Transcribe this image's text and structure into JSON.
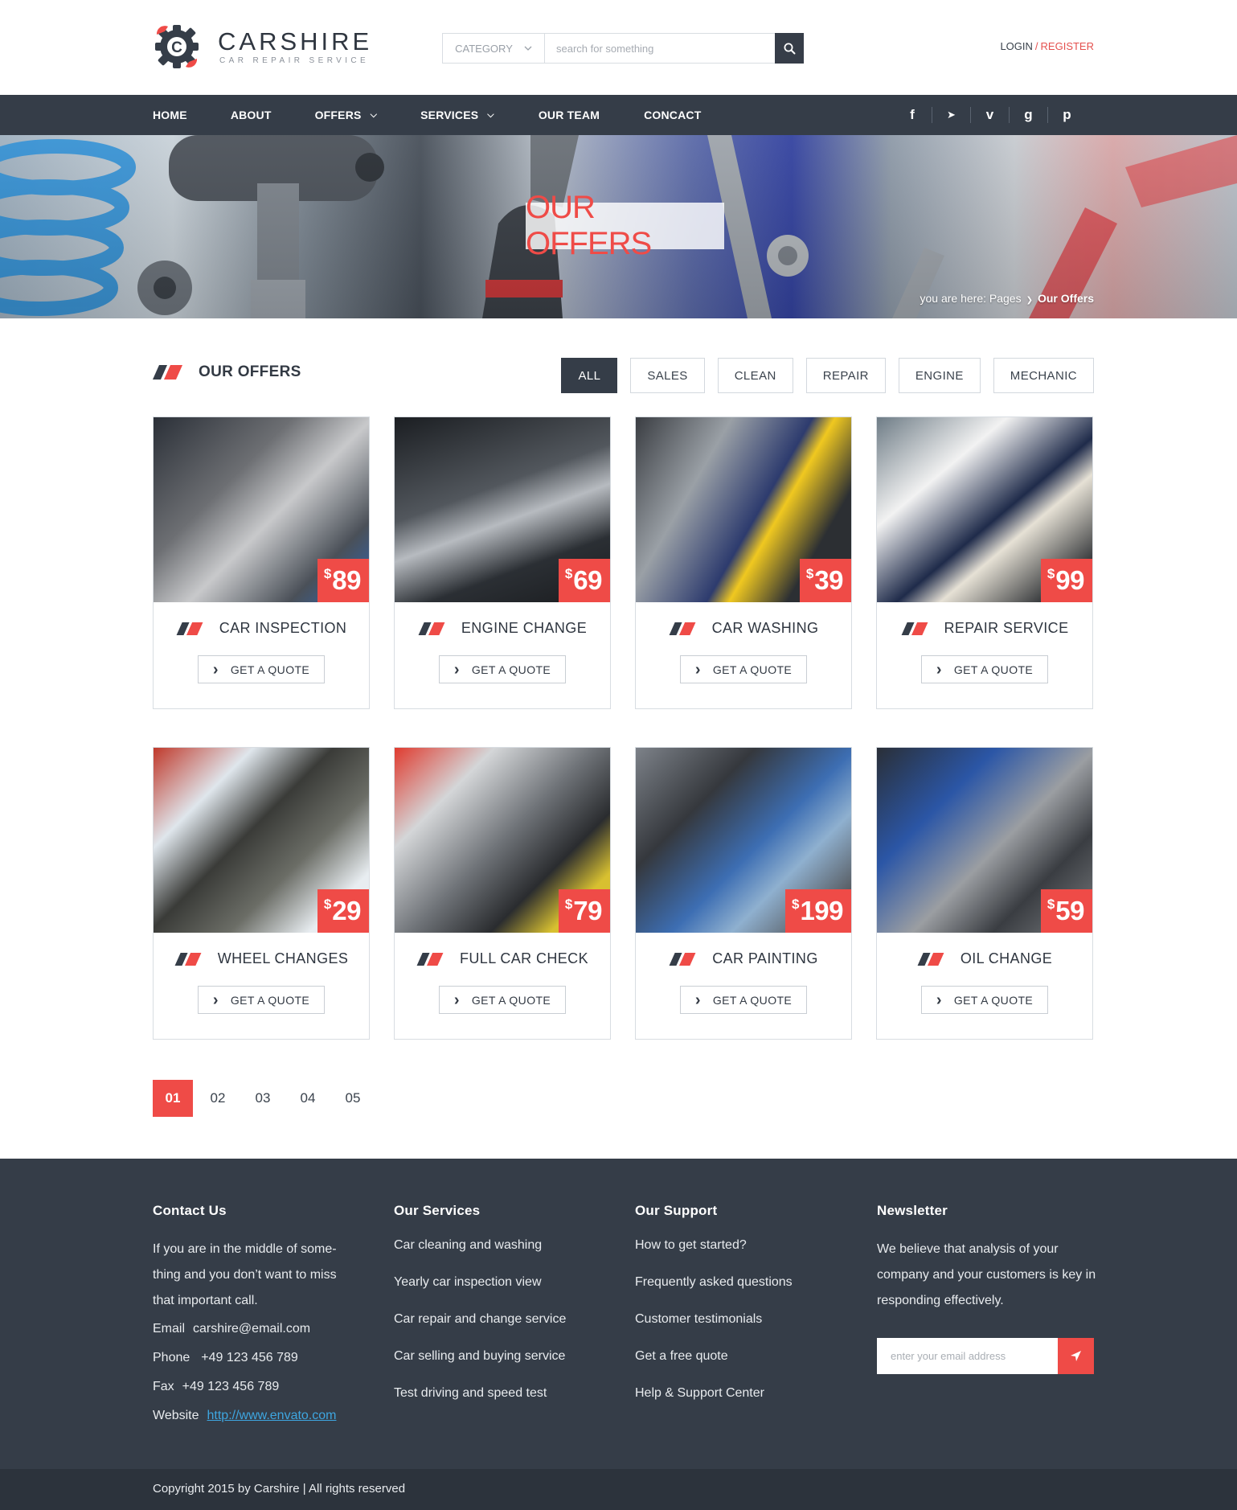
{
  "brand": {
    "name": "CARSHIRE",
    "tagline": "CAR REPAIR SERVICE",
    "letter": "C"
  },
  "search": {
    "category_label": "CATEGORY",
    "placeholder": "search for something"
  },
  "auth": {
    "login": "LOGIN",
    "separator": "/",
    "register": "REGISTER"
  },
  "nav": {
    "items": [
      {
        "label": "HOME",
        "dropdown": false
      },
      {
        "label": "ABOUT",
        "dropdown": false
      },
      {
        "label": "OFFERS",
        "dropdown": true
      },
      {
        "label": "SERVICES",
        "dropdown": true
      },
      {
        "label": "OUR TEAM",
        "dropdown": false
      },
      {
        "label": "CONCACT",
        "dropdown": false
      }
    ],
    "socials": [
      {
        "name": "facebook-icon",
        "glyph": "f"
      },
      {
        "name": "twitter-icon",
        "glyph": "➤"
      },
      {
        "name": "vimeo-icon",
        "glyph": "v"
      },
      {
        "name": "google-plus-icon",
        "glyph": "g"
      },
      {
        "name": "pinterest-icon",
        "glyph": "p"
      }
    ]
  },
  "hero": {
    "title": "OUR OFFERS",
    "breadcrumb_prefix": "you are here: Pages",
    "breadcrumb_current": "Our Offers"
  },
  "section": {
    "title": "OUR OFFERS",
    "filters": [
      {
        "label": "ALL",
        "active": true
      },
      {
        "label": "SALES",
        "active": false
      },
      {
        "label": "CLEAN",
        "active": false
      },
      {
        "label": "REPAIR",
        "active": false
      },
      {
        "label": "ENGINE",
        "active": false
      },
      {
        "label": "MECHANIC",
        "active": false
      }
    ]
  },
  "offers": [
    {
      "title": "CAR INSPECTION",
      "currency": "$",
      "price": "89",
      "button": "GET A QUOTE"
    },
    {
      "title": "ENGINE CHANGE",
      "currency": "$",
      "price": "69",
      "button": "GET A QUOTE"
    },
    {
      "title": "CAR WASHING",
      "currency": "$",
      "price": "39",
      "button": "GET A QUOTE"
    },
    {
      "title": "REPAIR SERVICE",
      "currency": "$",
      "price": "99",
      "button": "GET A QUOTE"
    },
    {
      "title": "WHEEL CHANGES",
      "currency": "$",
      "price": "29",
      "button": "GET A QUOTE"
    },
    {
      "title": "FULL CAR CHECK",
      "currency": "$",
      "price": "79",
      "button": "GET A QUOTE"
    },
    {
      "title": "CAR PAINTING",
      "currency": "$",
      "price": "199",
      "button": "GET A QUOTE"
    },
    {
      "title": "OIL CHANGE",
      "currency": "$",
      "price": "59",
      "button": "GET A QUOTE"
    }
  ],
  "pagination": {
    "pages": [
      "01",
      "02",
      "03",
      "04",
      "05"
    ],
    "active": "01"
  },
  "footer": {
    "contact": {
      "heading": "Contact Us",
      "intro": "If you are in the middle of some-thing and you don’t want to miss that important call.",
      "email_label": "Email",
      "email": "carshire@email.com",
      "phone_label": "Phone",
      "phone": "+49 123 456 789",
      "fax_label": "Fax",
      "fax": "+49 123 456 789",
      "website_label": "Website",
      "website": "http://www.envato.com"
    },
    "services": {
      "heading": "Our Services",
      "items": [
        "Car cleaning and washing",
        "Yearly car inspection view",
        "Car repair and change service",
        "Car selling and buying service",
        "Test driving and speed test"
      ]
    },
    "support": {
      "heading": "Our Support",
      "items": [
        "How to get started?",
        "Frequently asked questions",
        "Customer testimonials",
        "Get a free quote",
        "Help & Support Center"
      ]
    },
    "newsletter": {
      "heading": "Newsletter",
      "text": "We believe that analysis of your company and your customers is key in responding effectively.",
      "placeholder": "enter your email address"
    },
    "copyright": "Copyright 2015 by Carshire | All rights reserved"
  },
  "colors": {
    "accent": "#ef4b47",
    "dark": "#353d48",
    "footer": "#353d48",
    "copyright_bar": "#2c333c"
  }
}
